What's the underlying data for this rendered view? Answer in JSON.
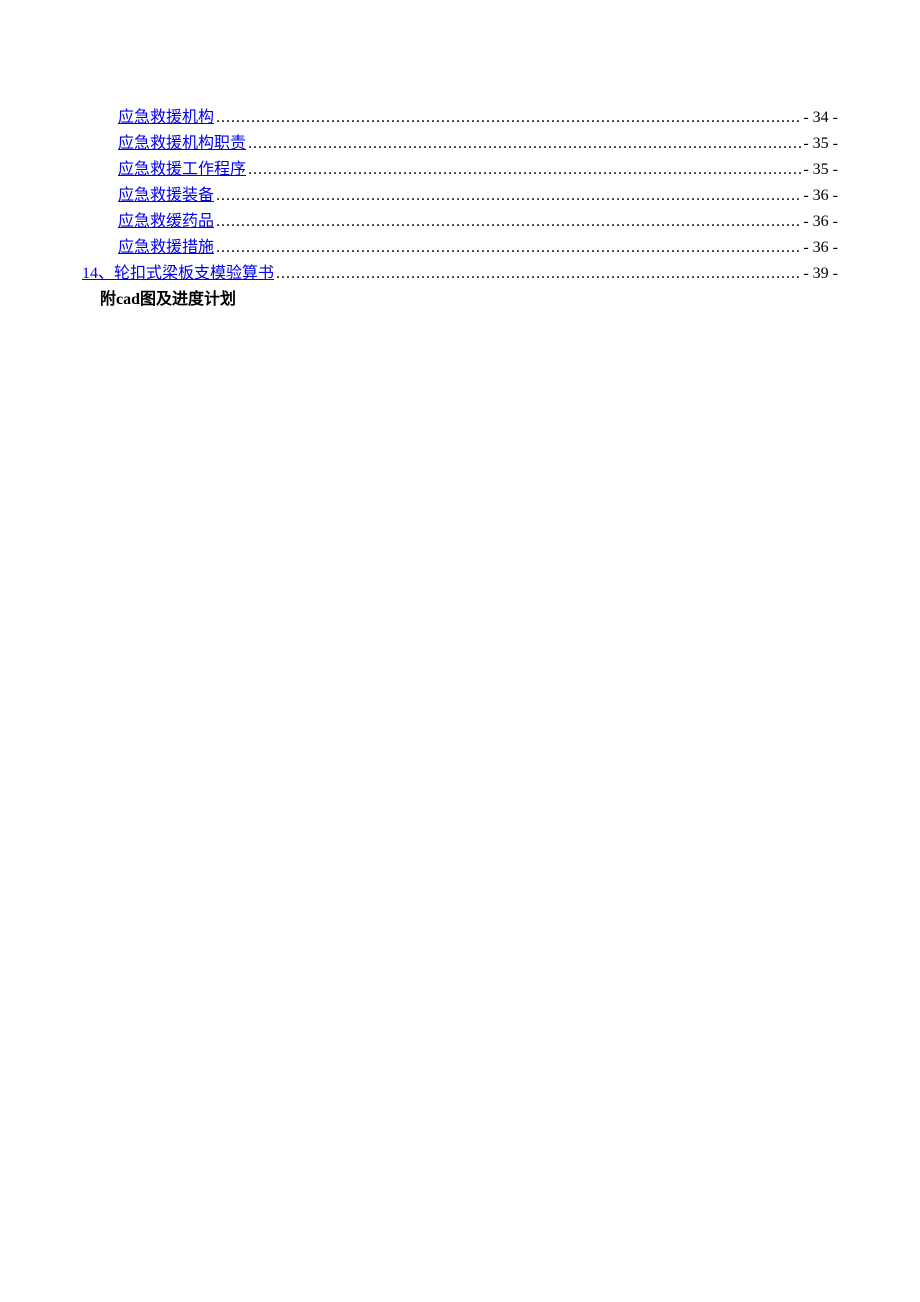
{
  "toc": {
    "entries": [
      {
        "level": 2,
        "label": "应急救援机构",
        "page": "- 34 -"
      },
      {
        "level": 2,
        "label": "应急救援机构职责",
        "page": "- 35 -"
      },
      {
        "level": 2,
        "label": "应急救援工作程序",
        "page": "- 35 -"
      },
      {
        "level": 2,
        "label": "应急救援装备",
        "page": "- 36 -"
      },
      {
        "level": 2,
        "label": "应急救缓药品",
        "page": "- 36 -"
      },
      {
        "level": 2,
        "label": "应急救援措施",
        "page": "- 36 -"
      },
      {
        "level": 1,
        "label": "14、轮扣式梁板支模验算书",
        "page": "- 39 -"
      }
    ]
  },
  "appendix": {
    "prefix": "附",
    "bold_part": "cad",
    "suffix": "图及进度计划"
  },
  "dots": "...................................................................................................................................................................................................................."
}
